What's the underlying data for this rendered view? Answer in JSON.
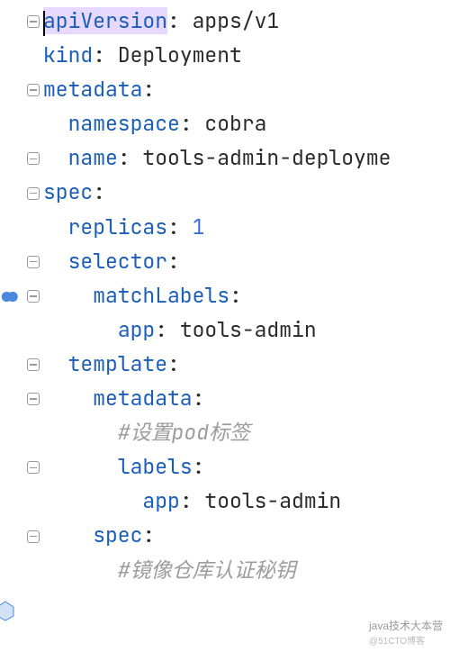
{
  "code": {
    "lines": [
      {
        "indent": "",
        "key": "apiVersion",
        "sep": ": ",
        "val": "apps/v1",
        "highlightKey": true,
        "cursor": true,
        "fold": "minus"
      },
      {
        "indent": "",
        "key": "kind",
        "sep": ": ",
        "val": "Deployment",
        "fold": null
      },
      {
        "indent": "",
        "key": "metadata",
        "sep": ":",
        "val": "",
        "fold": "minus"
      },
      {
        "indent": "  ",
        "key": "namespace",
        "sep": ": ",
        "val": "cobra",
        "fold": null
      },
      {
        "indent": "  ",
        "key": "name",
        "sep": ": ",
        "val": "tools-admin-deployme",
        "fold": "minus"
      },
      {
        "indent": "",
        "key": "spec",
        "sep": ":",
        "val": "",
        "fold": "minus"
      },
      {
        "indent": "  ",
        "key": "replicas",
        "sep": ": ",
        "val": "1",
        "num": true,
        "fold": null
      },
      {
        "indent": "  ",
        "key": "selector",
        "sep": ":",
        "val": "",
        "fold": "minus"
      },
      {
        "indent": "    ",
        "key": "matchLabels",
        "sep": ":",
        "val": "",
        "fold": "minus",
        "extra": "breakpoint"
      },
      {
        "indent": "      ",
        "key": "app",
        "sep": ": ",
        "val": "tools-admin",
        "fold": null
      },
      {
        "indent": "  ",
        "key": "template",
        "sep": ":",
        "val": "",
        "fold": "minus"
      },
      {
        "indent": "    ",
        "key": "metadata",
        "sep": ":",
        "val": "",
        "fold": "minus"
      },
      {
        "indent": "      ",
        "comment": "#设置pod标签",
        "fold": null
      },
      {
        "indent": "      ",
        "key": "labels",
        "sep": ":",
        "val": "",
        "fold": "minus"
      },
      {
        "indent": "        ",
        "key": "app",
        "sep": ": ",
        "val": "tools-admin",
        "fold": null
      },
      {
        "indent": "    ",
        "key": "spec",
        "sep": ":",
        "val": "",
        "fold": "minus"
      },
      {
        "indent": "      ",
        "comment": "#镜像仓库认证秘钥",
        "fold": null
      }
    ]
  },
  "watermark": {
    "main": "java技术大本营",
    "sub": "@51CTO博客"
  }
}
